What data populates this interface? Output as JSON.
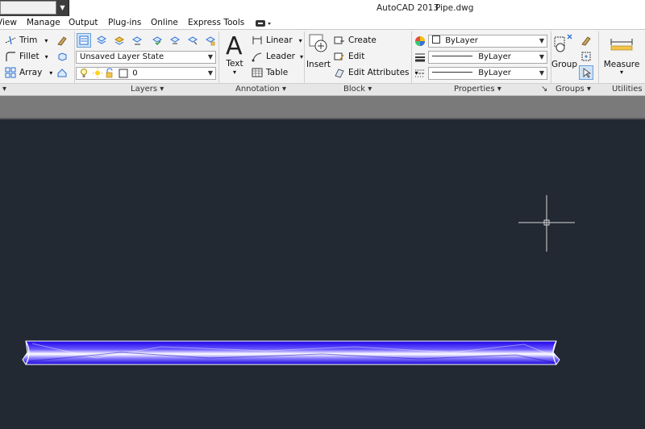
{
  "titlebar": {
    "app_title": "AutoCAD 2013",
    "file_name": "Pipe.dwg",
    "workspace_value": ""
  },
  "tabs": [
    {
      "label": "View"
    },
    {
      "label": "Manage"
    },
    {
      "label": "Output"
    },
    {
      "label": "Plug-ins"
    },
    {
      "label": "Online"
    },
    {
      "label": "Express Tools"
    }
  ],
  "modify": {
    "trim": "Trim",
    "fillet": "Fillet",
    "array": "Array"
  },
  "layers": {
    "title": "Layers",
    "layer_state": "Unsaved Layer State",
    "current_layer": "0"
  },
  "annotation": {
    "title": "Annotation",
    "text": "Text",
    "linear": "Linear",
    "leader": "Leader",
    "table": "Table"
  },
  "block": {
    "title": "Block",
    "insert": "Insert",
    "create": "Create",
    "edit": "Edit",
    "edit_attributes": "Edit Attributes"
  },
  "properties": {
    "title": "Properties",
    "color": "ByLayer",
    "linetype": "ByLayer",
    "lineweight": "ByLayer"
  },
  "groups": {
    "title": "Groups",
    "group": "Group"
  },
  "utilities": {
    "title": "Utilities",
    "measure": "Measure"
  },
  "colors": {
    "canvas": "#222933",
    "pipe_blue": "#1c00f5",
    "pipe_highlight": "#ffffff",
    "crosshair": "#d8d8d8"
  }
}
